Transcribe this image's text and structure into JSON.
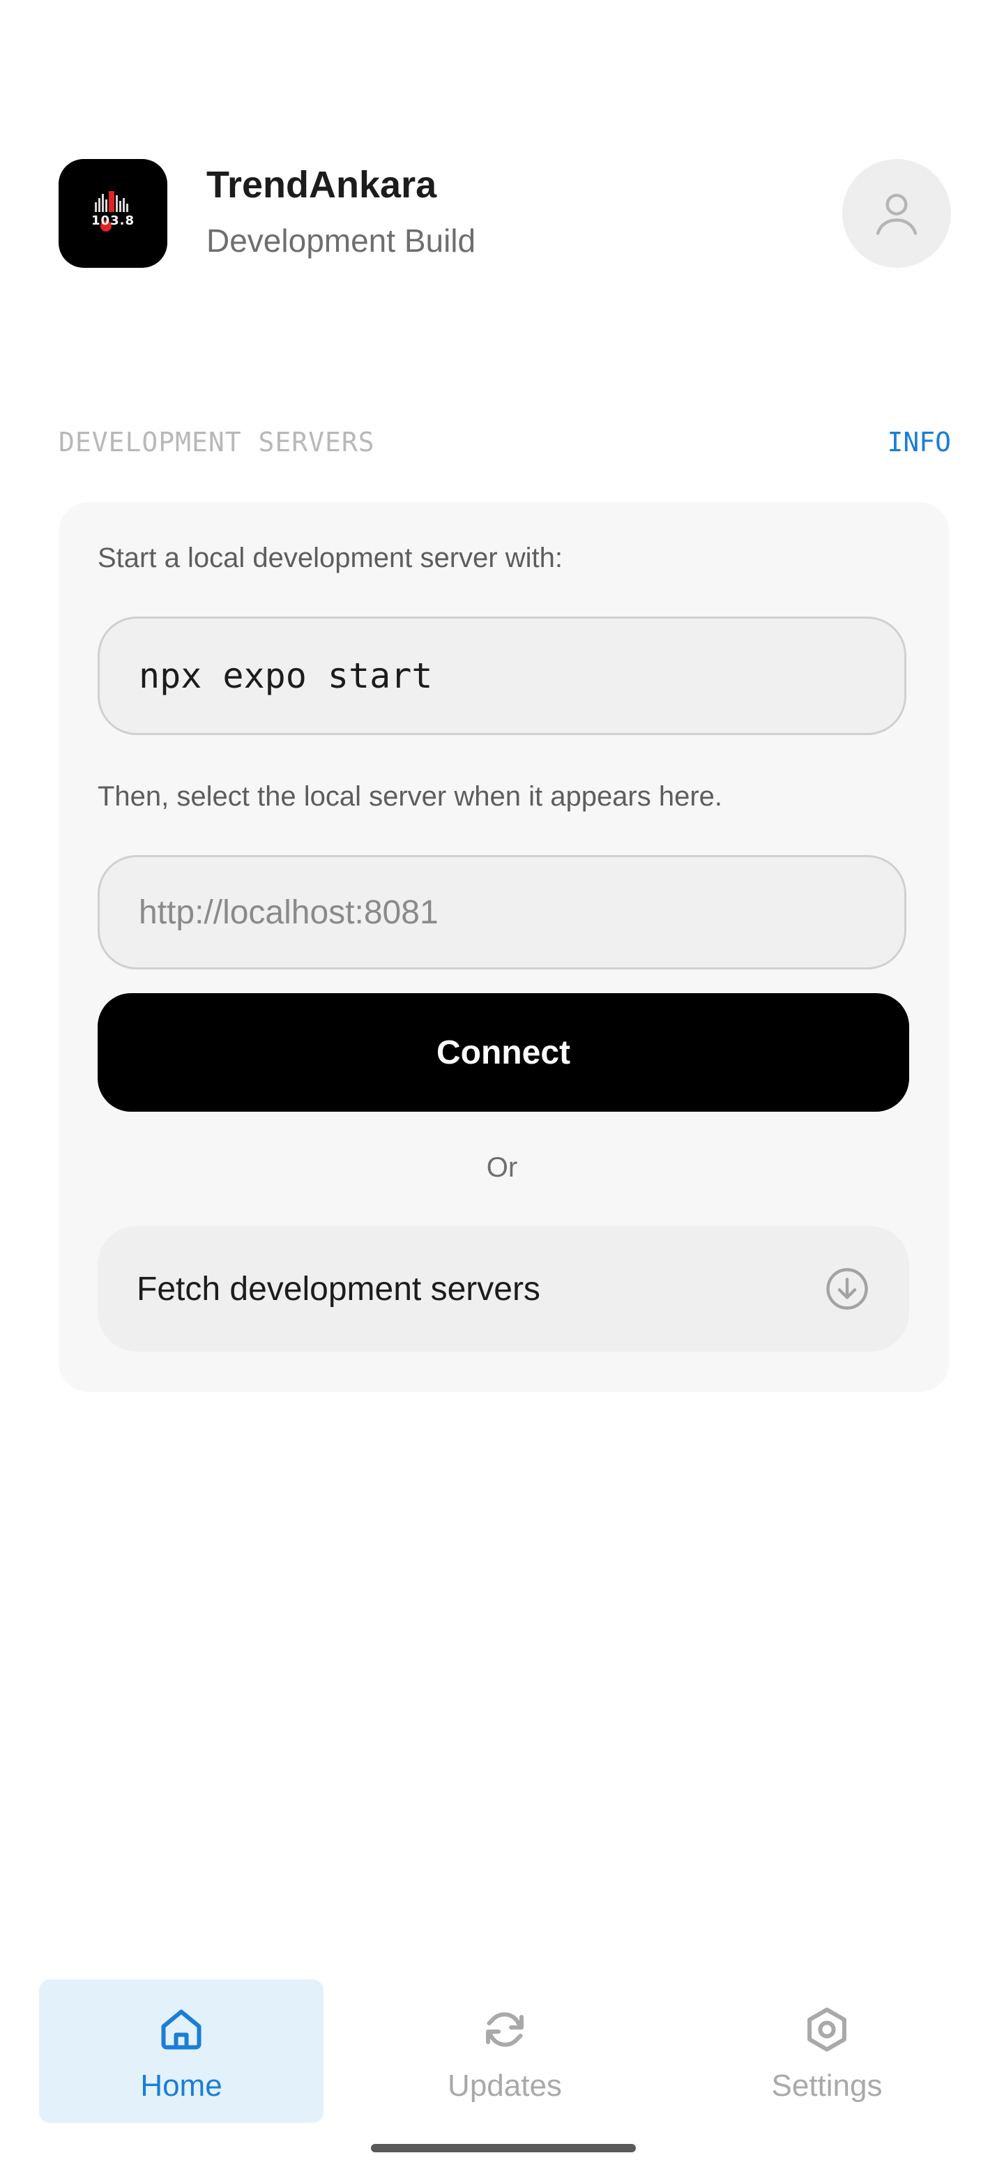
{
  "header": {
    "app_name": "TrendAnkara",
    "build_type": "Development Build",
    "logo_text": "103.8",
    "avatar_icon": "user-icon"
  },
  "servers": {
    "section_label": "DEVELOPMENT SERVERS",
    "info_label": "INFO",
    "instruction_start": "Start a local development server with:",
    "command": "npx expo start",
    "instruction_select": "Then, select the local server when it appears here.",
    "url_placeholder": "http://localhost:8081",
    "url_value": "",
    "connect_label": "Connect",
    "or_label": "Or",
    "fetch_label": "Fetch development servers",
    "fetch_icon": "download-circle-icon"
  },
  "tabs": [
    {
      "label": "Home",
      "icon": "home-icon",
      "active": true
    },
    {
      "label": "Updates",
      "icon": "refresh-icon",
      "active": false
    },
    {
      "label": "Settings",
      "icon": "settings-icon",
      "active": false
    }
  ],
  "colors": {
    "accent": "#1a7ed6",
    "active_tab_bg": "#e3f1fb",
    "inactive": "#a9a9a9",
    "button": "#000000",
    "card_bg": "#f7f7f7"
  }
}
